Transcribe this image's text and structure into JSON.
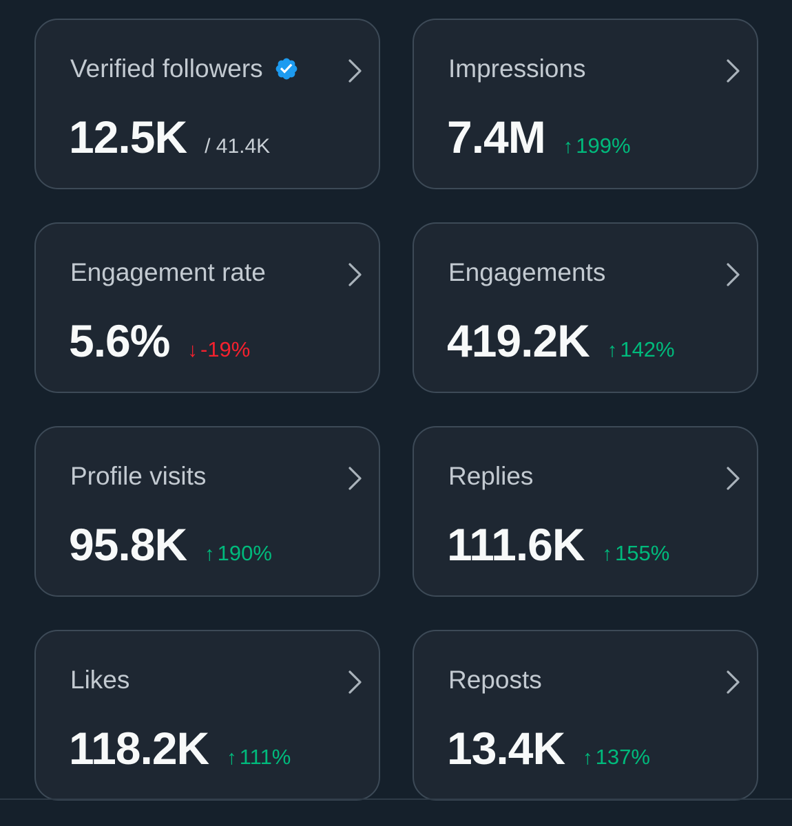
{
  "cards": [
    {
      "title": "Verified followers",
      "value": "12.5K",
      "total": "/ 41.4K",
      "verified_icon": "verified-badge-icon",
      "icon_color": "#1d9bf0"
    },
    {
      "title": "Impressions",
      "value": "7.4M",
      "change": "199%",
      "direction": "up"
    },
    {
      "title": "Engagement rate",
      "value": "5.6%",
      "change": "-19%",
      "direction": "down"
    },
    {
      "title": "Engagements",
      "value": "419.2K",
      "change": "142%",
      "direction": "up"
    },
    {
      "title": "Profile visits",
      "value": "95.8K",
      "change": "190%",
      "direction": "up"
    },
    {
      "title": "Replies",
      "value": "111.6K",
      "change": "155%",
      "direction": "up"
    },
    {
      "title": "Likes",
      "value": "118.2K",
      "change": "111%",
      "direction": "up"
    },
    {
      "title": "Reposts",
      "value": "13.4K",
      "change": "137%",
      "direction": "up"
    }
  ],
  "arrows": {
    "up": "↑",
    "down": "↓"
  },
  "colors": {
    "background": "#15202b",
    "card": "#1e2732",
    "border": "#3d4a57",
    "positive": "#00ba7c",
    "negative": "#f4212e",
    "verified": "#1d9bf0"
  },
  "icons": {
    "chevron": "chevron-right-icon",
    "verified": "verified-badge-icon"
  }
}
